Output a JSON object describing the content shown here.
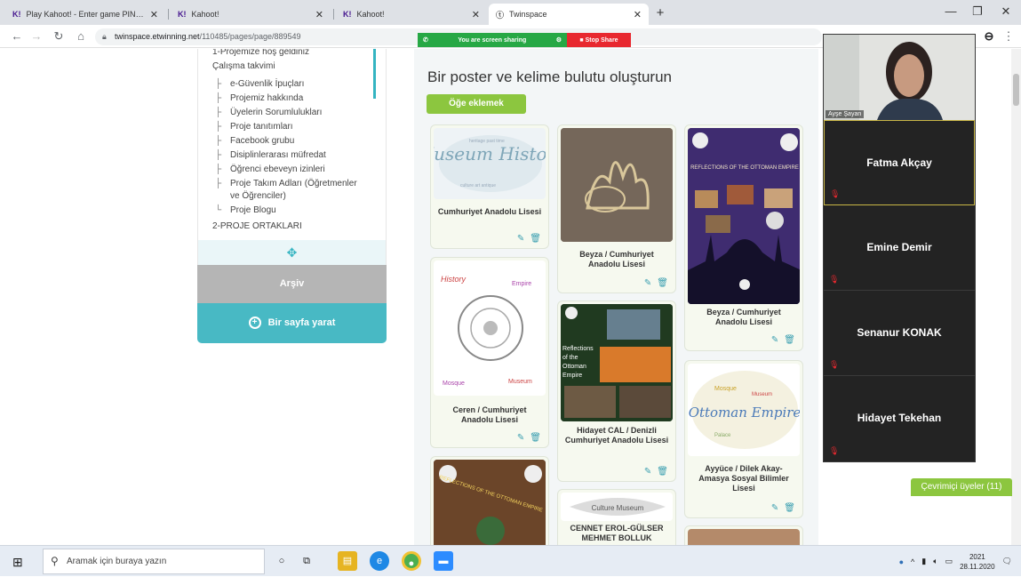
{
  "browser": {
    "tabs": [
      {
        "favicon": "K!",
        "label": "Play Kahoot! - Enter game PIN h..."
      },
      {
        "favicon": "K!",
        "label": "Kahoot!"
      },
      {
        "favicon": "K!",
        "label": "Kahoot!"
      },
      {
        "favicon": "ⓣ",
        "label": "Twinspace"
      }
    ],
    "url_host": "twinspace.etwinning.net",
    "url_path": "/110485/pages/page/889549"
  },
  "sidebar": {
    "tree": [
      {
        "label": "1-Projemize hoş geldiniz",
        "child": false
      },
      {
        "label": "Çalışma takvimi",
        "child": false
      },
      {
        "label": "e-Güvenlik İpuçları",
        "child": true
      },
      {
        "label": "Projemiz hakkında",
        "child": true
      },
      {
        "label": "Üyelerin Sorumlulukları",
        "child": true
      },
      {
        "label": "Proje tanıtımları",
        "child": true
      },
      {
        "label": "Facebook grubu",
        "child": true
      },
      {
        "label": "Disiplinlerarası müfredat",
        "child": true
      },
      {
        "label": "Öğrenci ebeveyn izinleri",
        "child": true
      },
      {
        "label": "Proje Takım Adları (Öğretmenler",
        "child": true
      },
      {
        "label": "ve Öğrenciler)",
        "child": true
      },
      {
        "label": "Proje Blogu",
        "child": true
      },
      {
        "label": "2-PROJE ORTAKLARI",
        "child": false
      }
    ],
    "archive_label": "Arşiv",
    "create_page_label": "Bir sayfa yarat"
  },
  "main": {
    "title": "Bir poster ve kelime bulutu oluşturun",
    "add_item_label": "Öğe eklemek",
    "cards": [
      {
        "caption": "Cumhuriyet Anadolu Lisesi",
        "thumb_text": "Museum History"
      },
      {
        "caption": "Ceren / Cumhuriyet Anadolu Lisesi",
        "thumb_text": "History Empire"
      },
      {
        "caption": "",
        "thumb_text": "REFLECTIONS OF THE OTTOMAN EMPIRE"
      },
      {
        "caption": "Beyza / Cumhuriyet Anadolu Lisesi",
        "thumb_text": ""
      },
      {
        "caption": "Hidayet CAL / Denizli Cumhuriyet Anadolu Lisesi",
        "thumb_text": "Reflections of the Ottoman Empire"
      },
      {
        "caption": "CENNET EROL-GÜLSER MEHMET BOLLUK",
        "thumb_text": "Culture Museum"
      },
      {
        "caption": "Beyza / Cumhuriyet Anadolu Lisesi",
        "thumb_text": "REFLECTIONS OF THE OTTOMAN EMPIRE"
      },
      {
        "caption": "Ayyüce / Dilek Akay-Amasya Sosyal Bilimler Lisesi",
        "thumb_text": "Ottoman Empire"
      },
      {
        "caption": "",
        "thumb_text": ""
      }
    ]
  },
  "screen_share": {
    "status": "You are screen sharing",
    "stop_label": "Stop Share"
  },
  "video": {
    "self_name": "Ayşe Şayan",
    "participants": [
      "Fatma Akçay",
      "Emine Demir",
      "Senanur KONAK",
      "Hidayet Tekehan"
    ]
  },
  "online_label": "Çevrimiçi üyeler (11)",
  "taskbar": {
    "search_placeholder": "Aramak için buraya yazın",
    "time": "2021",
    "date": "28.11.2020"
  },
  "colors": {
    "accent_teal": "#48b9c4",
    "accent_green": "#8cc63f",
    "share_green": "#27a845",
    "stop_red": "#e8282f"
  }
}
